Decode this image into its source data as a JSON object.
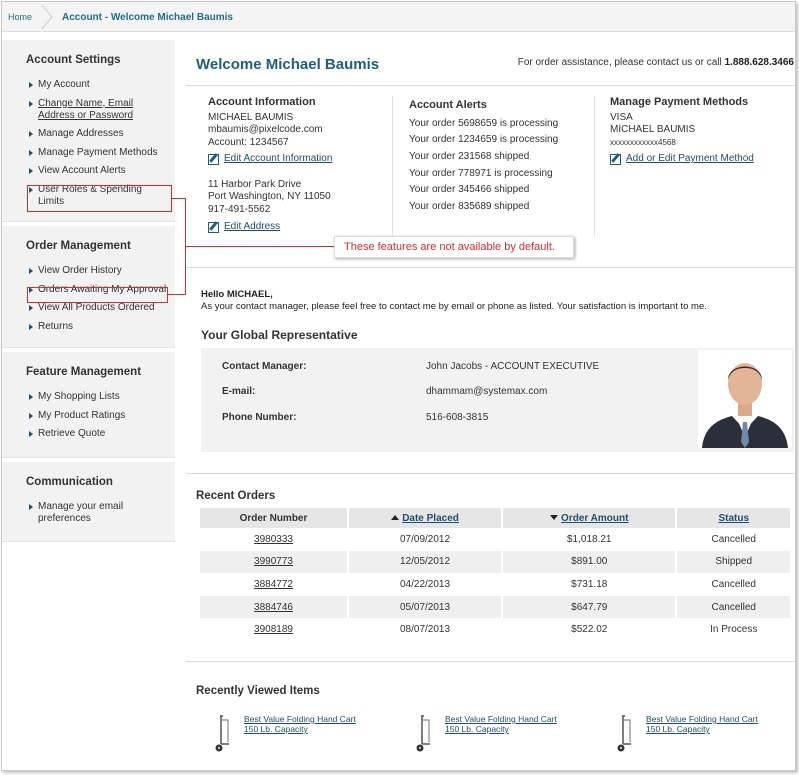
{
  "breadcrumb": {
    "home": "Home",
    "current": "Account - Welcome Michael Baumis"
  },
  "sidebar": {
    "account_settings": {
      "title": "Account Settings",
      "items": [
        "My Account",
        "Change Name, Email",
        "Address or Password",
        "Manage Addresses",
        "Manage Payment Methods",
        "View Account Alerts",
        "User Roles & Spending",
        "Limits"
      ]
    },
    "order_management": {
      "title": "Order Management",
      "items": [
        "View Order History",
        "Orders Awaiting My Approval",
        "View All Products Ordered",
        "Returns"
      ]
    },
    "feature_management": {
      "title": "Feature Management",
      "items": [
        "My Shopping Lists",
        "My Product Ratings",
        "Retrieve Quote"
      ]
    },
    "communication": {
      "title": "Communication",
      "items": [
        "Manage your email",
        "preferences"
      ]
    }
  },
  "annotation": {
    "text": "These features are not available by default.",
    "color": "#d62e2e"
  },
  "header": {
    "welcome": "Welcome Michael Baumis",
    "assist_text": "For order assistance, please contact us or call",
    "assist_phone": "1.888.628.3466"
  },
  "account_info": {
    "title": "Account Information",
    "name": "MICHAEL BAUMIS",
    "email": "mbaumis@pixelcode.com",
    "account": "Account: 1234567",
    "edit_link": "Edit Account Information",
    "address1": "11 Harbor Park Drive",
    "address2": "Port Washington, NY 11050",
    "phone": "917-491-5562",
    "edit_address": "Edit Address"
  },
  "account_alerts": {
    "title": "Account Alerts",
    "alerts": [
      "Your order 5698659 is processing",
      "Your order 1234659 is processing",
      "Your order 231568 shipped",
      "Your order 778971 is processing",
      "Your order 345466 shipped",
      "Your order 835689 shipped"
    ]
  },
  "payment": {
    "title": "Manage Payment Methods",
    "type": "VISA",
    "name": "MICHAEL BAUMIS",
    "card": "xxxxxxxxxxxx4568",
    "link": "Add or Edit Payment Method"
  },
  "greeting": {
    "hello": "Hello MICHAEL,",
    "message": "As your contact manager, please feel free to contact me by email or phone as listed. Your satisfaction is important to me."
  },
  "representative": {
    "title": "Your Global Representative",
    "labels": {
      "manager": "Contact Manager:",
      "email": "E-mail:",
      "phone": "Phone Number:"
    },
    "values": {
      "manager": "John Jacobs - ACCOUNT EXECUTIVE",
      "email": "dhammam@systemax.com",
      "phone": "516-608-3815"
    }
  },
  "recent_orders": {
    "title": "Recent Orders",
    "headers": {
      "number": "Order Number",
      "date": "Date Placed",
      "amount": "Order Amount",
      "status": "Status"
    },
    "rows": [
      {
        "number": "3980333",
        "date": "07/09/2012",
        "amount": "$1,018.21",
        "status": "Cancelled"
      },
      {
        "number": "3990773",
        "date": "12/05/2012",
        "amount": "$891.00",
        "status": "Shipped"
      },
      {
        "number": "3884772",
        "date": "04/22/2013",
        "amount": "$731.18",
        "status": "Cancelled"
      },
      {
        "number": "3884746",
        "date": "05/07/2013",
        "amount": "$647.79",
        "status": "Cancelled"
      },
      {
        "number": "3908189",
        "date": "08/07/2013",
        "amount": "$522.02",
        "status": "In Process"
      }
    ]
  },
  "recently_viewed": {
    "title": "Recently Viewed Items",
    "items": [
      {
        "line1": "Best Value Folding Hand Cart",
        "line2": "150 Lb. Capacity"
      },
      {
        "line1": "Best Value Folding Hand Cart",
        "line2": "150 Lb. Capacity"
      },
      {
        "line1": "Best Value Folding Hand Cart",
        "line2": "150 Lb. Capacity"
      }
    ]
  }
}
